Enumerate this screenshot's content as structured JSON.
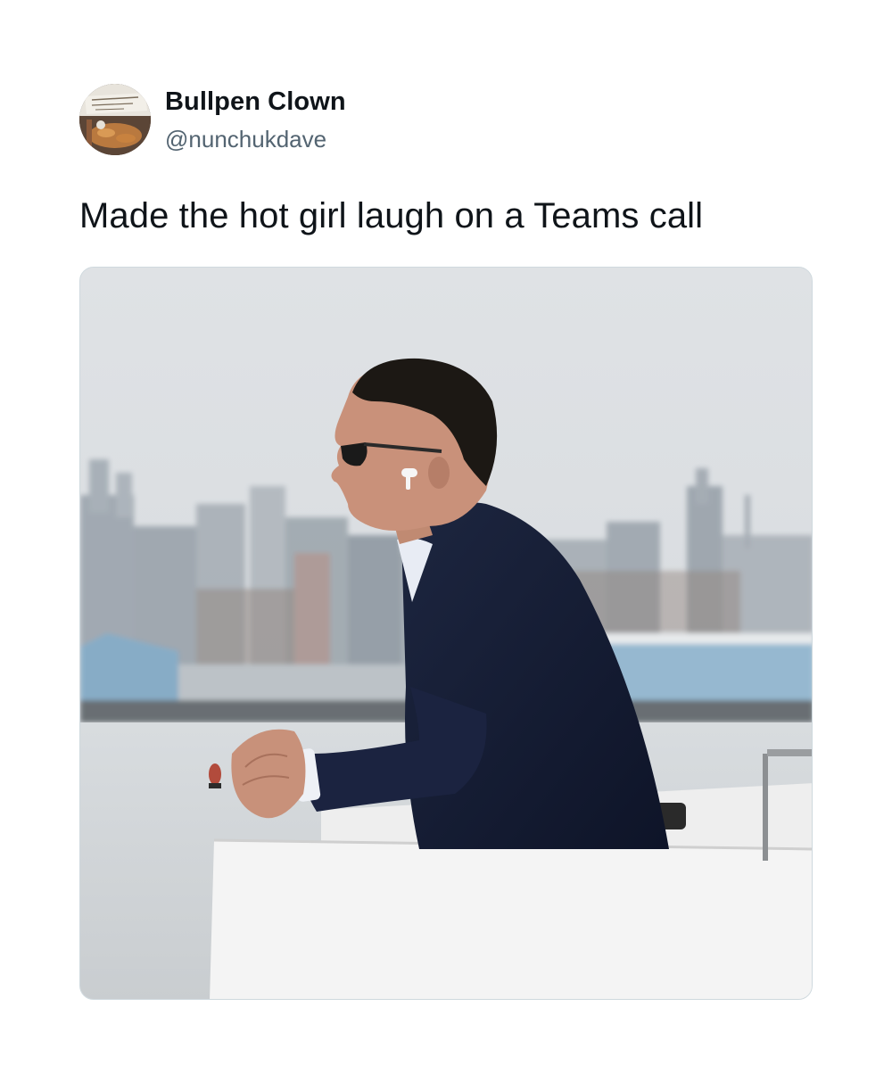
{
  "tweet": {
    "author": {
      "display_name": "Bullpen Clown",
      "handle": "@nunchukdave",
      "avatar_icon": "profile-photo-icon",
      "avatar_text": "Bein being Flaky is a Good Thing"
    },
    "text": "Made the hot girl laugh on a Teams call",
    "media": {
      "icon": "photo-icon",
      "description": "man in suit and sunglasses leaning on boat railing with city skyline"
    }
  },
  "colors": {
    "text_primary": "#0f1419",
    "text_secondary": "#536471",
    "border": "#cfd9de",
    "background": "#ffffff"
  }
}
